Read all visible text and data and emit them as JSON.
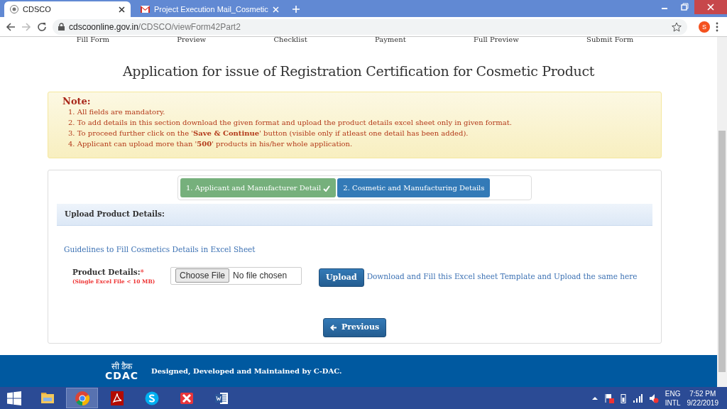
{
  "browser": {
    "tabs": [
      {
        "title": "CDSCO",
        "selected": true
      },
      {
        "title": "Project Execution Mail_Cosmetic",
        "selected": false
      }
    ],
    "url": {
      "domain": "cdscoonline.gov.in",
      "path": "/CDSCO/viewForm42Part2"
    },
    "profile_initial": "S"
  },
  "steps_nav": [
    "Fill Form",
    "Preview",
    "Checklist",
    "Payment",
    "Full Preview",
    "Submit Form"
  ],
  "title": "Application for issue of Registration Certification for Cosmetic Product",
  "note": {
    "heading": "Note:",
    "items": [
      "1. All fields are mandatory.",
      "2. To add details in this section download the given format and upload the product details excel sheet only in given format.",
      "3. To proceed further click on the '**Save & Continue**' button (visible only if atleast one detail has been added).",
      "4. Applicant can upload more than '**500**' products in his/her whole application."
    ]
  },
  "wizard": [
    {
      "label": "1. Applicant and Manufacturer Detail",
      "completed": true,
      "selected": false
    },
    {
      "label": "2. Cosmetic and Manufacturing Details",
      "completed": false,
      "selected": true
    }
  ],
  "section": {
    "heading": "Upload Product Details:",
    "guidelines_link": "Guidelines to Fill Cosmetics Details in Excel Sheet",
    "field": {
      "label": "Product Details:",
      "required_mark": "*",
      "hint": "(Single Excel File < 10 MB)",
      "button": "Choose File",
      "value": "No file chosen"
    },
    "upload_button": "Upload",
    "template_link": "Download and Fill this Excel sheet Template and Upload the same here",
    "previous_button": "Previous"
  },
  "footer": {
    "logo_hindi": "सी डैक",
    "logo_text": "CDAC",
    "text": "Designed, Developed and Maintained by C-DAC."
  },
  "taskbar": {
    "apps": [
      {
        "kind": "explorer",
        "selected": false
      },
      {
        "kind": "chrome",
        "selected": true
      },
      {
        "kind": "pdf",
        "selected": false
      },
      {
        "kind": "skype",
        "selected": false
      },
      {
        "kind": "xmind",
        "selected": false
      },
      {
        "kind": "word",
        "selected": false
      }
    ],
    "language": "ENG",
    "layout": "INTL",
    "time": "7:52 PM",
    "date": "9/22/2019"
  }
}
